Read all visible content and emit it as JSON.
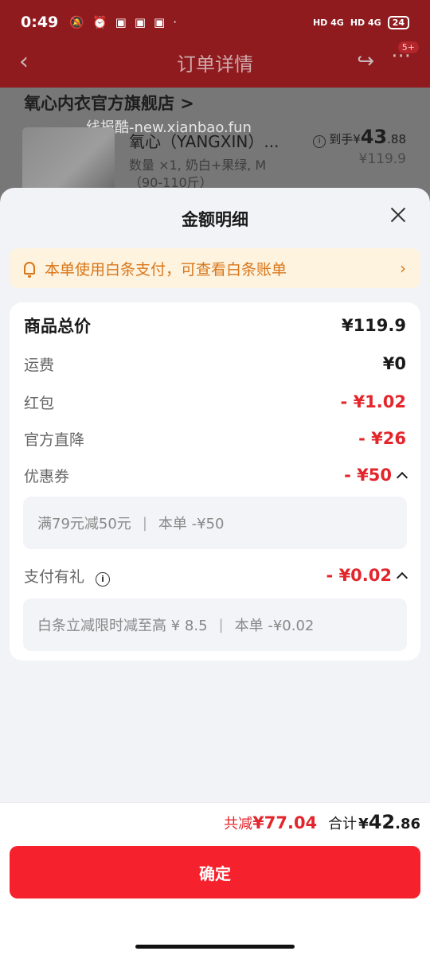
{
  "status_bar": {
    "time": "0:49",
    "network_1": "HD 4G",
    "network_2": "HD 4G",
    "battery": "24"
  },
  "nav": {
    "title": "订单详情",
    "badge": "5+"
  },
  "background": {
    "shop_name": "氧心内衣官方旗舰店 >",
    "watermark": "线报酷-new.xianbao.fun",
    "product_name": "氧心（YANGXIN）...",
    "product_spec": "数量 ×1, 奶白+果绿, M（90-110斤）",
    "price_prefix": "到手¥",
    "price_int": "43",
    "price_dec": ".88",
    "original_price": "¥119.9"
  },
  "sheet": {
    "title": "金额明细",
    "notice": "本单使用白条支付，可查看白条账单",
    "rows": {
      "total": {
        "label": "商品总价",
        "value": "¥119.9"
      },
      "shipping": {
        "label": "运费",
        "value": "¥0"
      },
      "redpacket": {
        "label": "红包",
        "value": "- ¥1.02"
      },
      "official_drop": {
        "label": "官方直降",
        "value": "- ¥26"
      },
      "coupon": {
        "label": "优惠券",
        "value": "- ¥50"
      },
      "pay_gift": {
        "label": "支付有礼",
        "value": "- ¥0.02"
      }
    },
    "coupon_detail": {
      "rule": "满79元减50元",
      "applied": "本单 -¥50"
    },
    "pay_gift_detail": {
      "rule": "白条立减限时减至高 ¥ 8.5",
      "applied": "本单 -¥0.02"
    }
  },
  "footer": {
    "saved_label": "共减",
    "saved_value": "¥77.04",
    "total_label": "合计",
    "total_yen": "¥",
    "total_int": "42",
    "total_dec": ".86",
    "confirm_label": "确定"
  },
  "colors": {
    "accent_red": "#f5222d",
    "discount_red": "#e3262c",
    "notice_orange": "#d9761a",
    "notice_bg": "#fdf3de"
  }
}
